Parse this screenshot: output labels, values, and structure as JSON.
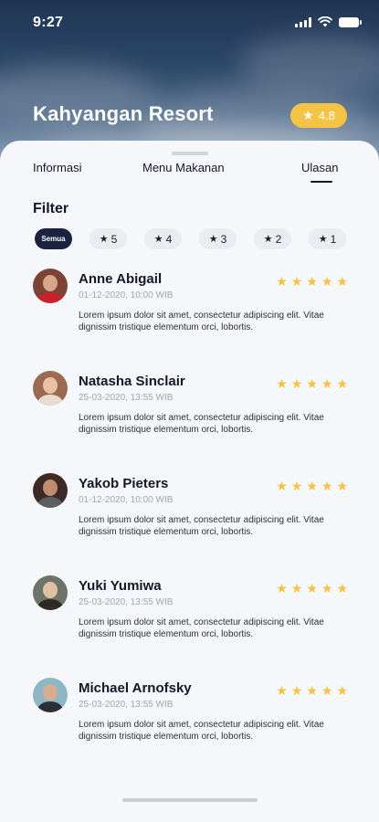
{
  "status": {
    "time": "9:27"
  },
  "header": {
    "title": "Kahyangan Resort",
    "rating": "4.8",
    "rating_icon": "star-icon"
  },
  "tabs": [
    {
      "label": "Informasi",
      "active": false
    },
    {
      "label": "Menu Makanan",
      "active": false
    },
    {
      "label": "Ulasan",
      "active": true
    }
  ],
  "filter": {
    "label": "Filter",
    "chips": [
      {
        "label": "Semua",
        "active": true
      },
      {
        "label": "5",
        "active": false
      },
      {
        "label": "4",
        "active": false
      },
      {
        "label": "3",
        "active": false
      },
      {
        "label": "2",
        "active": false
      },
      {
        "label": "1",
        "active": false
      }
    ]
  },
  "reviews": [
    {
      "name": "Anne Abigail",
      "date": "01-12-2020, 10:00 WIB",
      "rating": 5,
      "text": "Lorem ipsum dolor sit amet, consectetur adipiscing elit. Vitae dignissim tristique elementum orci, lobortis."
    },
    {
      "name": "Natasha Sinclair",
      "date": "25-03-2020, 13:55 WIB",
      "rating": 5,
      "text": "Lorem ipsum dolor sit amet, consectetur adipiscing elit. Vitae dignissim tristique elementum orci, lobortis."
    },
    {
      "name": "Yakob Pieters",
      "date": "01-12-2020, 10:00 WIB",
      "rating": 5,
      "text": "Lorem ipsum dolor sit amet, consectetur adipiscing elit. Vitae dignissim tristique elementum orci, lobortis."
    },
    {
      "name": "Yuki Yumiwa",
      "date": "25-03-2020, 13:55 WIB",
      "rating": 5,
      "text": "Lorem ipsum dolor sit amet, consectetur adipiscing elit. Vitae dignissim tristique elementum orci, lobortis."
    },
    {
      "name": "Michael Arnofsky",
      "date": "25-03-2020, 13:55 WIB",
      "rating": 5,
      "text": "Lorem ipsum dolor sit amet, consectetur adipiscing elit. Vitae dignissim tristique elementum orci, lobortis."
    }
  ],
  "colors": {
    "accent_star": "#f5c242",
    "rating_badge": "#f6c445",
    "active_chip": "#1b2340",
    "chip_bg": "#e9ecf1",
    "sheet_bg": "#f5f7fb"
  }
}
